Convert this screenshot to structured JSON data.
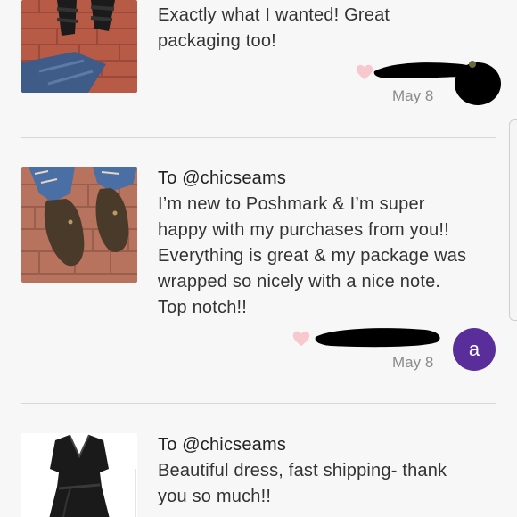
{
  "reviews": [
    {
      "to": "",
      "text_lines": [
        "Exactly what I wanted! Great",
        "packaging too!"
      ],
      "date": "May 8",
      "avatar": "",
      "thumb": "black-sandals"
    },
    {
      "to": "To @chicseams",
      "text_lines": [
        "I’m new to Poshmark & I’m super",
        "happy with my purchases from you!!",
        "Everything is great & my package was",
        "wrapped so nicely with a nice note.",
        "Top notch!!"
      ],
      "date": "May 8",
      "avatar": "a",
      "thumb": "brown-clogs"
    },
    {
      "to": "To @chicseams",
      "text_lines": [
        "Beautiful dress, fast shipping- thank",
        "you so much!!"
      ],
      "date": "",
      "avatar": "",
      "thumb": "black-wrap-dress"
    }
  ],
  "colors": {
    "heart": "#f7c9cf",
    "avatar": "#5a2e9a",
    "divider": "#d7d7d7",
    "redaction": "#000000"
  }
}
